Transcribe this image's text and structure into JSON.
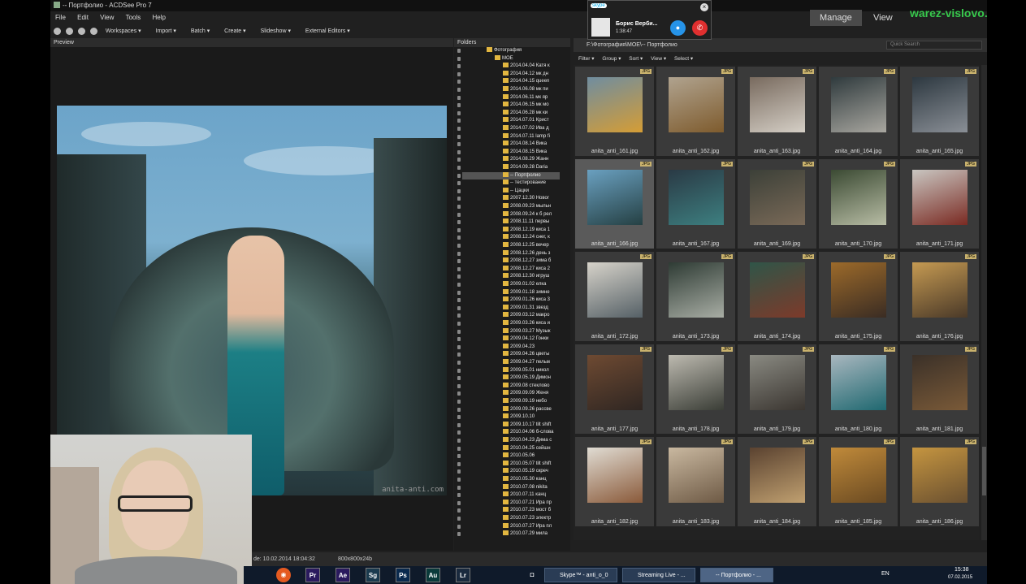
{
  "window": {
    "title": "-- Портфолио - ACDSee Pro 7"
  },
  "menu": [
    "File",
    "Edit",
    "View",
    "Tools",
    "Help"
  ],
  "toolbar": [
    "Workspaces ▾",
    "Import ▾",
    "Batch ▾",
    "Create ▾",
    "Slideshow ▾",
    "External Editors ▾"
  ],
  "preview": {
    "header": "Preview",
    "watermark": "anita-anti.com"
  },
  "folders": {
    "header": "Folders",
    "items": [
      {
        "label": "Фотография",
        "indent": 0
      },
      {
        "label": "MOE",
        "indent": 1
      },
      {
        "label": "2014.04.04 Катя к",
        "indent": 2
      },
      {
        "label": "2014.04.12 мк дн",
        "indent": 2
      },
      {
        "label": "2014.04.15 queen",
        "indent": 2
      },
      {
        "label": "2014.06.08 мк пи",
        "indent": 2
      },
      {
        "label": "2014.06.11 мк яр",
        "indent": 2
      },
      {
        "label": "2014.06.15 мк мо",
        "indent": 2
      },
      {
        "label": "2014.06.28 мк ки",
        "indent": 2
      },
      {
        "label": "2014.07.01 Крист",
        "indent": 2
      },
      {
        "label": "2014.07.02 Ива д",
        "indent": 2
      },
      {
        "label": "2014.07.11 lamp fi",
        "indent": 2
      },
      {
        "label": "2014.08.14 Вика",
        "indent": 2
      },
      {
        "label": "2014.08.15 Вика",
        "indent": 2
      },
      {
        "label": "2014.08.29 Жанн",
        "indent": 2
      },
      {
        "label": "2014.09.28 Daria",
        "indent": 2
      },
      {
        "label": "-- Портфолио",
        "indent": 2,
        "selected": true
      },
      {
        "label": "-- тестирование",
        "indent": 2
      },
      {
        "label": "-- Цацки",
        "indent": 2
      },
      {
        "label": "2007.12.30 Новог",
        "indent": 2
      },
      {
        "label": "2008.09.23 мыльн",
        "indent": 2
      },
      {
        "label": "2008.09.24 к б рел",
        "indent": 2
      },
      {
        "label": "2008.11.11 первы",
        "indent": 2
      },
      {
        "label": "2008.12.19 киса 1",
        "indent": 2
      },
      {
        "label": "2008.12.24 снег, к",
        "indent": 2
      },
      {
        "label": "2008.12.25 вечер",
        "indent": 2
      },
      {
        "label": "2008.12.26 день з",
        "indent": 2
      },
      {
        "label": "2008.12.27 зима б",
        "indent": 2
      },
      {
        "label": "2008.12.27 киса 2",
        "indent": 2
      },
      {
        "label": "2008.12.30 игруш",
        "indent": 2
      },
      {
        "label": "2009.01.02 елка",
        "indent": 2
      },
      {
        "label": "2009.01.18 зимне",
        "indent": 2
      },
      {
        "label": "2009.01.26 киса 3",
        "indent": 2
      },
      {
        "label": "2009.01.31 звезд",
        "indent": 2
      },
      {
        "label": "2009.03.12 макро",
        "indent": 2
      },
      {
        "label": "2009.03.26 киса и",
        "indent": 2
      },
      {
        "label": "2009.03.27 Музык",
        "indent": 2
      },
      {
        "label": "2009.04.12 Гонки",
        "indent": 2
      },
      {
        "label": "2009.04.23",
        "indent": 2
      },
      {
        "label": "2009.04.26 цветы",
        "indent": 2
      },
      {
        "label": "2009.04.27 пельм",
        "indent": 2
      },
      {
        "label": "2009.05.01 никол",
        "indent": 2
      },
      {
        "label": "2009.05.19 Димон",
        "indent": 2
      },
      {
        "label": "2009.08 стеклово",
        "indent": 2
      },
      {
        "label": "2009.09.09 Женя",
        "indent": 2
      },
      {
        "label": "2009.09.19 небо",
        "indent": 2
      },
      {
        "label": "2009.09.26 рассве",
        "indent": 2
      },
      {
        "label": "2009.10.10",
        "indent": 2
      },
      {
        "label": "2009.10.17 tilt shift",
        "indent": 2
      },
      {
        "label": "2010.04.06 б-слова",
        "indent": 2
      },
      {
        "label": "2010.04.23 Дима с",
        "indent": 2
      },
      {
        "label": "2010.04.25 сейшн",
        "indent": 2
      },
      {
        "label": "2010.05.06",
        "indent": 2
      },
      {
        "label": "2010.05.07 tilt shift",
        "indent": 2
      },
      {
        "label": "2010.05.19 скреч",
        "indent": 2
      },
      {
        "label": "2010.05.30 канц",
        "indent": 2
      },
      {
        "label": "2010.07.08 nikita",
        "indent": 2
      },
      {
        "label": "2010.07.11 канц",
        "indent": 2
      },
      {
        "label": "2010.07.21 Ира пр",
        "indent": 2
      },
      {
        "label": "2010.07.23 мост б",
        "indent": 2
      },
      {
        "label": "2010.07.23 электр",
        "indent": 2
      },
      {
        "label": "2010.07.27 Ира пл",
        "indent": 2
      },
      {
        "label": "2010.07.29 мила",
        "indent": 2
      }
    ]
  },
  "browser": {
    "path": "F:\\Фотография\\MOE\\-- Портфолио",
    "search_placeholder": "Quick Search",
    "toolbar": [
      "Filter ▾",
      "Group ▾",
      "Sort ▾",
      "View ▾",
      "Select ▾"
    ],
    "badge": "JPG",
    "thumbnails": [
      {
        "name": "anita_anti_161.jpg",
        "tone": [
          "#6f8da0",
          "#d59d35"
        ]
      },
      {
        "name": "anita_anti_162.jpg",
        "tone": [
          "#b0a38f",
          "#7e5b2d"
        ]
      },
      {
        "name": "anita_anti_163.jpg",
        "tone": [
          "#786a5e",
          "#d5cfc6"
        ]
      },
      {
        "name": "anita_anti_164.jpg",
        "tone": [
          "#2f3a3d",
          "#a9a7a0"
        ]
      },
      {
        "name": "anita_anti_165.jpg",
        "tone": [
          "#2d3840",
          "#8a8f96"
        ]
      },
      {
        "name": "anita_anti_166.jpg",
        "tone": [
          "#6aa0c0",
          "#254043"
        ],
        "selected": true
      },
      {
        "name": "anita_anti_167.jpg",
        "tone": [
          "#2a3a45",
          "#3d7f80"
        ]
      },
      {
        "name": "anita_anti_169.jpg",
        "tone": [
          "#3c4038",
          "#7a6a58"
        ]
      },
      {
        "name": "anita_anti_170.jpg",
        "tone": [
          "#3b4a33",
          "#b7bca4"
        ]
      },
      {
        "name": "anita_anti_171.jpg",
        "tone": [
          "#c9c6c1",
          "#7a2a22"
        ]
      },
      {
        "name": "anita_anti_172.jpg",
        "tone": [
          "#d7d3ca",
          "#556066"
        ]
      },
      {
        "name": "anita_anti_173.jpg",
        "tone": [
          "#2e3b34",
          "#a8ada4"
        ]
      },
      {
        "name": "anita_anti_174.jpg",
        "tone": [
          "#2f5548",
          "#7d3a2a"
        ]
      },
      {
        "name": "anita_anti_175.jpg",
        "tone": [
          "#9c6a2a",
          "#3a2c23"
        ]
      },
      {
        "name": "anita_anti_176.jpg",
        "tone": [
          "#c59a52",
          "#4a3928"
        ]
      },
      {
        "name": "anita_anti_177.jpg",
        "tone": [
          "#6e4a32",
          "#2f2622"
        ]
      },
      {
        "name": "anita_anti_178.jpg",
        "tone": [
          "#bdbab0",
          "#3a3d36"
        ]
      },
      {
        "name": "anita_anti_179.jpg",
        "tone": [
          "#8a8a82",
          "#3a3530"
        ]
      },
      {
        "name": "anita_anti_180.jpg",
        "tone": [
          "#a9b7bf",
          "#1f6870"
        ]
      },
      {
        "name": "anita_anti_181.jpg",
        "tone": [
          "#3a3028",
          "#7a5a38"
        ]
      },
      {
        "name": "anita_anti_182.jpg",
        "tone": [
          "#e0dcd3",
          "#8a5a3a"
        ]
      },
      {
        "name": "anita_anti_183.jpg",
        "tone": [
          "#c9b8a0",
          "#6e5a45"
        ]
      },
      {
        "name": "anita_anti_184.jpg",
        "tone": [
          "#5a4230",
          "#c0a070"
        ]
      },
      {
        "name": "anita_anti_185.jpg",
        "tone": [
          "#c08a3a",
          "#6a4a22"
        ]
      },
      {
        "name": "anita_anti_186.jpg",
        "tone": [
          "#c59540",
          "#6a5030"
        ]
      }
    ]
  },
  "modes": [
    "Manage",
    "View"
  ],
  "site_watermark": "warez-vislovo.ru",
  "skype_call": {
    "logo": "skype",
    "caller": "Борис Верби...",
    "duration": "1:38:47"
  },
  "status": {
    "date": "de: 10.02.2014 18:04:32",
    "dims": "800x800x24b"
  },
  "taskbar": {
    "apps": [
      {
        "label": "Pr",
        "color": "#2a1a5e"
      },
      {
        "label": "Ae",
        "color": "#2a1a5e"
      },
      {
        "label": "Sg",
        "color": "#1a3a4e"
      },
      {
        "label": "Ps",
        "color": "#0a2a4e"
      },
      {
        "label": "Au",
        "color": "#0a3a3a"
      },
      {
        "label": "Lr",
        "color": "#1a2a3e"
      }
    ],
    "windows": [
      {
        "label": "Skype™ - anti_o_0"
      },
      {
        "label": "Streaming Live - ..."
      },
      {
        "label": "-- Портфолио - ..."
      }
    ],
    "lang": "EN",
    "time": "15:38",
    "date": "07.02.2015"
  }
}
